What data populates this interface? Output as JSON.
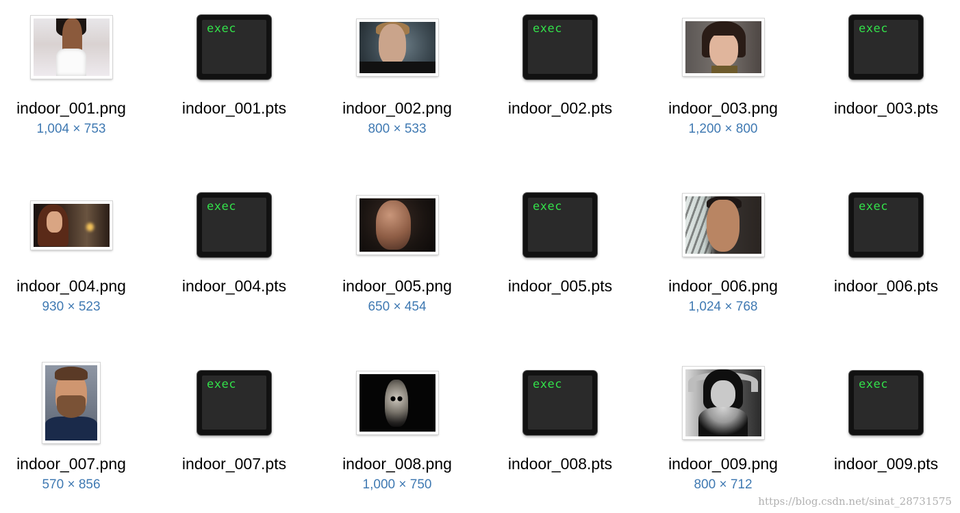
{
  "files": [
    {
      "name": "indoor_001.png",
      "dims": "1,004 × 753",
      "kind": "image",
      "preview": "photo-1"
    },
    {
      "name": "indoor_001.pts",
      "dims": "",
      "kind": "exec",
      "icon_label": "exec"
    },
    {
      "name": "indoor_002.png",
      "dims": "800 × 533",
      "kind": "image",
      "preview": "photo-2"
    },
    {
      "name": "indoor_002.pts",
      "dims": "",
      "kind": "exec",
      "icon_label": "exec"
    },
    {
      "name": "indoor_003.png",
      "dims": "1,200 × 800",
      "kind": "image",
      "preview": "photo-3"
    },
    {
      "name": "indoor_003.pts",
      "dims": "",
      "kind": "exec",
      "icon_label": "exec"
    },
    {
      "name": "indoor_004.png",
      "dims": "930 × 523",
      "kind": "image",
      "preview": "photo-4"
    },
    {
      "name": "indoor_004.pts",
      "dims": "",
      "kind": "exec",
      "icon_label": "exec"
    },
    {
      "name": "indoor_005.png",
      "dims": "650 × 454",
      "kind": "image",
      "preview": "photo-5"
    },
    {
      "name": "indoor_005.pts",
      "dims": "",
      "kind": "exec",
      "icon_label": "exec"
    },
    {
      "name": "indoor_006.png",
      "dims": "1,024 × 768",
      "kind": "image",
      "preview": "photo-6"
    },
    {
      "name": "indoor_006.pts",
      "dims": "",
      "kind": "exec",
      "icon_label": "exec"
    },
    {
      "name": "indoor_007.png",
      "dims": "570 × 856",
      "kind": "image",
      "preview": "photo-7"
    },
    {
      "name": "indoor_007.pts",
      "dims": "",
      "kind": "exec",
      "icon_label": "exec"
    },
    {
      "name": "indoor_008.png",
      "dims": "1,000 × 750",
      "kind": "image",
      "preview": "photo-8"
    },
    {
      "name": "indoor_008.pts",
      "dims": "",
      "kind": "exec",
      "icon_label": "exec"
    },
    {
      "name": "indoor_009.png",
      "dims": "800 × 712",
      "kind": "image",
      "preview": "photo-9"
    },
    {
      "name": "indoor_009.pts",
      "dims": "",
      "kind": "exec",
      "icon_label": "exec"
    }
  ],
  "watermark": "https://blog.csdn.net/sinat_28731575",
  "colors": {
    "filename": "#000000",
    "dimensions": "#3f79b2",
    "exec_text": "#33e14a",
    "exec_body": "#111111",
    "background": "#ffffff"
  }
}
